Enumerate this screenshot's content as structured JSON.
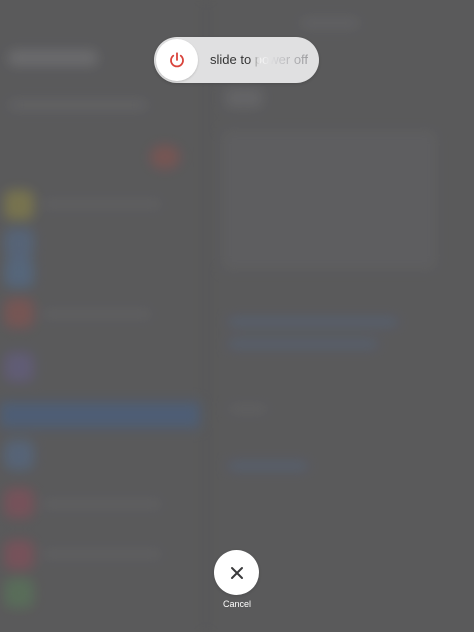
{
  "power_slider": {
    "label": "slide to power off",
    "icon": "power-icon",
    "icon_color": "#d9443c"
  },
  "cancel": {
    "label": "Cancel",
    "icon": "close-icon"
  },
  "colors": {
    "backdrop": "#606062",
    "slider_track": "#ebebed",
    "knob": "#ffffff",
    "text": "#2e2e30"
  }
}
